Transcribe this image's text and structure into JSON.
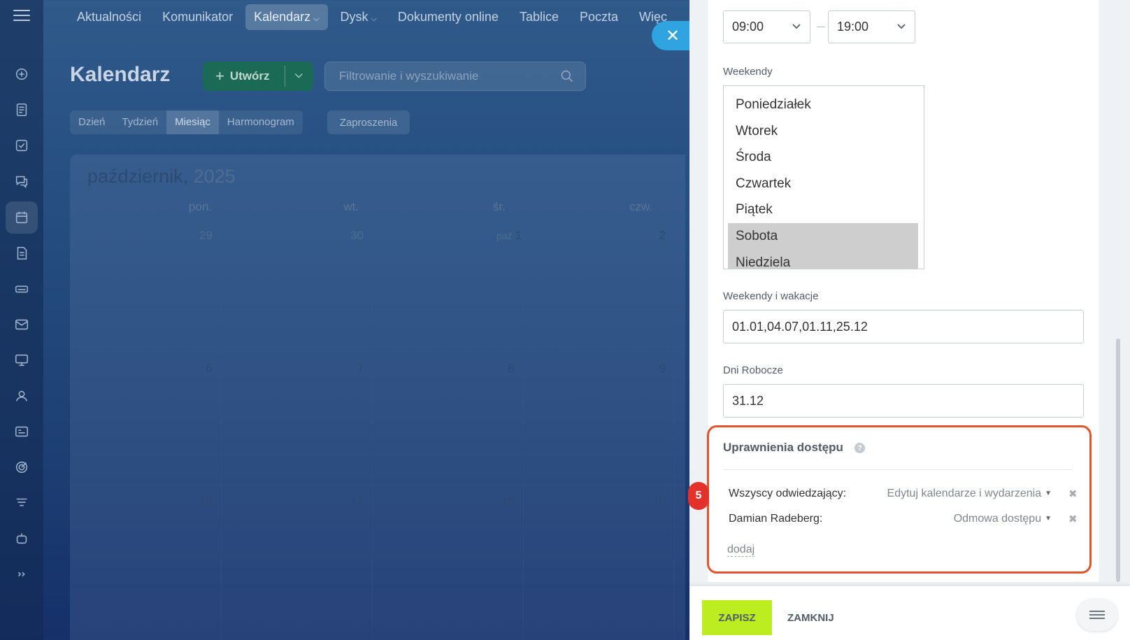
{
  "topnav": {
    "items": [
      {
        "label": "Aktualności"
      },
      {
        "label": "Komunikator"
      },
      {
        "label": "Kalendarz",
        "caret": "⌵"
      },
      {
        "label": "Dysk",
        "caret": "⌵"
      },
      {
        "label": "Dokumenty online"
      },
      {
        "label": "Tablice"
      },
      {
        "label": "Poczta"
      },
      {
        "label": "Więc"
      }
    ]
  },
  "header": {
    "title": "Kalendarz",
    "create_label": "Utwórz",
    "search_placeholder": "Filtrowanie i wyszukiwanie"
  },
  "view_tabs": [
    "Dzień",
    "Tydzień",
    "Miesiąc",
    "Harmonogram"
  ],
  "invites_label": "Zaproszenia",
  "calendar": {
    "month": "październik,",
    "year": "2025",
    "weekdays": [
      "pon.",
      "wt.",
      "śr.",
      "czw."
    ],
    "rows": [
      [
        "29",
        "30",
        "1",
        "2"
      ],
      [
        "6",
        "7",
        "8",
        "9"
      ],
      [
        "13",
        "14",
        "15",
        "16"
      ]
    ],
    "first_day_prefix": "paź"
  },
  "panel": {
    "work_time": {
      "from": "09:00",
      "to": "19:00"
    },
    "weekends": {
      "label": "Weekendy",
      "options": [
        {
          "label": "Poniedziałek",
          "selected": false
        },
        {
          "label": "Wtorek",
          "selected": false
        },
        {
          "label": "Środa",
          "selected": false
        },
        {
          "label": "Czwartek",
          "selected": false
        },
        {
          "label": "Piątek",
          "selected": false
        },
        {
          "label": "Sobota",
          "selected": true
        },
        {
          "label": "Niedziela",
          "selected": true
        }
      ]
    },
    "holidays": {
      "label": "Weekendy i wakacje",
      "value": "01.01,04.07,01.11,25.12"
    },
    "workdays": {
      "label": "Dni Robocze",
      "value": "31.12"
    },
    "access": {
      "title": "Uprawnienia dostępu",
      "help": "?",
      "rows": [
        {
          "who": "Wszyscy odwiedzający:",
          "level": "Edytuj kalendarze i wydarzenia"
        },
        {
          "who": "Damian Radeberg:",
          "level": "Odmowa dostępu"
        }
      ],
      "add_label": "dodaj",
      "step_badge": "5"
    },
    "footer": {
      "save_label": "ZAPISZ",
      "close_label": "ZAMKNIJ"
    }
  },
  "close_icon": "✕",
  "colors": {
    "accent_save": "#bbed21",
    "highlight_border": "#e4532c",
    "badge": "#e4312c",
    "close_button": "#2fa4e0"
  }
}
